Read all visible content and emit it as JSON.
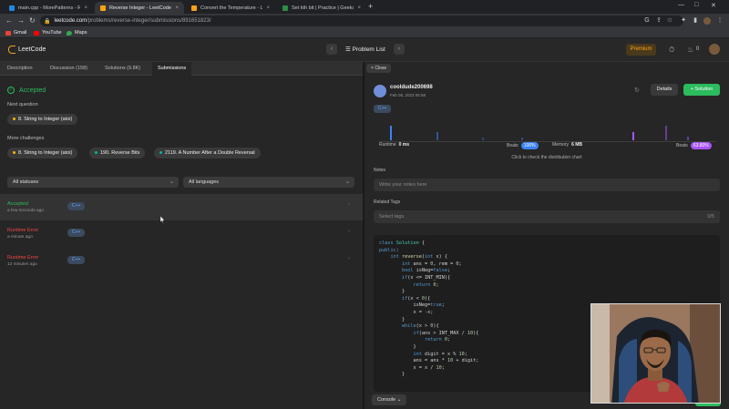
{
  "browser": {
    "tabs": [
      {
        "title": "main.cpp - MorePatterns - Rep",
        "color": "#1e88e5"
      },
      {
        "title": "Reverse Integer - LeetCode",
        "color": "#ffa116"
      },
      {
        "title": "Convert the Temperature - Lee",
        "color": "#ffa116"
      },
      {
        "title": "Set kth bit | Practice | Geeksfo",
        "color": "#2f8d46"
      }
    ],
    "url_host": "leetcode.com",
    "url_path": "/problems/reverse-integer/submissions/891651823/",
    "bookmarks": [
      {
        "label": "Gmail",
        "color": "#ea4335"
      },
      {
        "label": "YouTube",
        "color": "#ff0000"
      },
      {
        "label": "Maps",
        "color": "#34a853"
      }
    ]
  },
  "nav": {
    "logo": "LeetCode",
    "problem_list": "Problem List",
    "premium": "Premium",
    "streak": "0"
  },
  "left": {
    "tabs": [
      "Description",
      "Discussion (158)",
      "Solutions (9.8K)",
      "Submissions"
    ],
    "status": "Accepted",
    "next_question_label": "Next question",
    "next_question": "8. String to Integer (atoi)",
    "more_challenges_label": "More challenges",
    "challenges": [
      {
        "label": "8. String to Integer (atoi)",
        "color": "#ffb800"
      },
      {
        "label": "190. Reverse Bits",
        "color": "#00b8a3"
      },
      {
        "label": "2119. A Number After a Double Reversal",
        "color": "#00b8a3"
      }
    ],
    "filter_status": "All statuses",
    "filter_lang": "All languages",
    "submissions": [
      {
        "status": "Accepted",
        "time": "a few seconds ago",
        "lang": "C++",
        "color": "#2cbb5d"
      },
      {
        "status": "Runtime Error",
        "time": "a minute ago",
        "lang": "C++",
        "color": "#ef4743"
      },
      {
        "status": "Runtime Error",
        "time": "12 minutes ago",
        "lang": "C++",
        "color": "#ef4743"
      }
    ]
  },
  "right": {
    "close": "Close",
    "user": "cooldude200698",
    "date": "Feb 05, 2023 06:58",
    "details": "Details",
    "solution": "+ Solution",
    "lang": "C++",
    "runtime_label": "Runtime",
    "runtime_value": "0 ms",
    "beats_label": "Beats",
    "runtime_beats": "100%",
    "memory_label": "Memory",
    "memory_value": "6 MB",
    "memory_beats": "63.80%",
    "dist_hint": "Click to check the distribution chart",
    "notes_label": "Notes",
    "notes_placeholder": "Write your notes here",
    "tags_label": "Related Tags",
    "tags_placeholder": "Select tags",
    "tags_count": "0/5",
    "console": "Console"
  }
}
